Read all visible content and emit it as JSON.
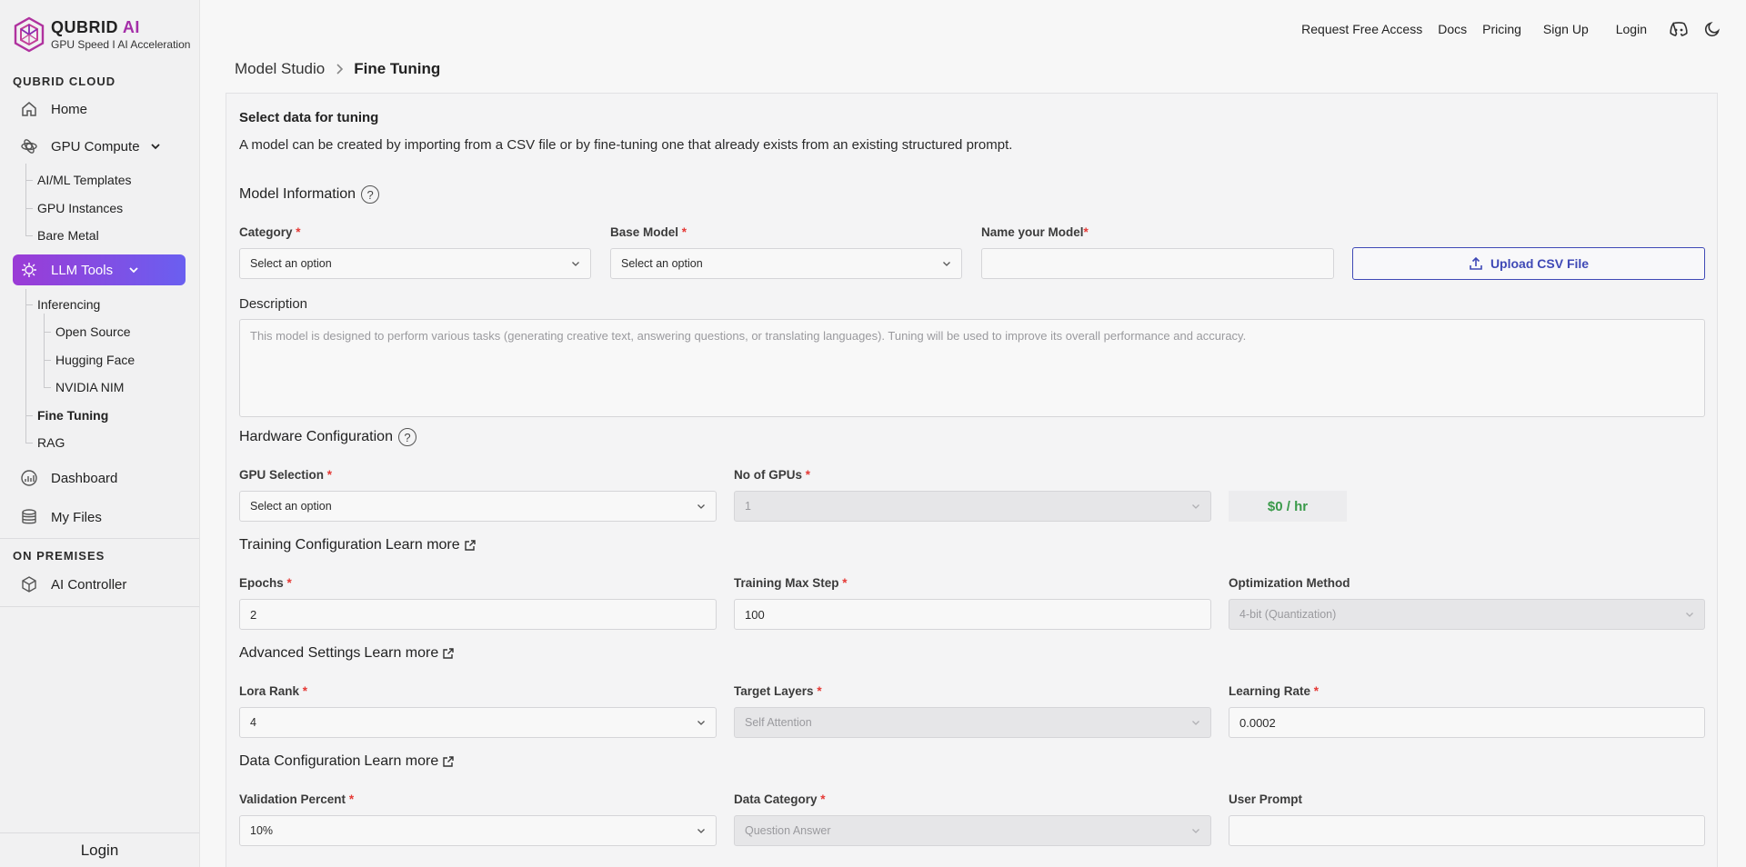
{
  "brand": {
    "name": "QUBRID",
    "name_suffix": "AI",
    "tagline": "GPU Speed I AI Acceleration"
  },
  "sidebar": {
    "cloud_title": "QUBRID CLOUD",
    "home": "Home",
    "gpu_compute": "GPU Compute",
    "gpu_sub": [
      "AI/ML Templates",
      "GPU Instances",
      "Bare Metal"
    ],
    "llm_tools": "LLM Tools",
    "inferencing": "Inferencing",
    "inferencing_sub": [
      "Open Source",
      "Hugging Face",
      "NVIDIA NIM"
    ],
    "fine_tuning": "Fine Tuning",
    "rag": "RAG",
    "dashboard": "Dashboard",
    "my_files": "My Files",
    "premises_title": "ON PREMISES",
    "ai_controller": "AI Controller",
    "login": "Login"
  },
  "topnav": {
    "request_access": "Request Free Access",
    "docs": "Docs",
    "pricing": "Pricing",
    "sign_up": "Sign Up",
    "login": "Login"
  },
  "breadcrumb": {
    "parent": "Model Studio",
    "current": "Fine Tuning"
  },
  "form": {
    "title": "Select data for tuning",
    "subtitle": "A model can be created by importing from a CSV file or by fine-tuning one that already exists from an existing structured prompt.",
    "model_info": {
      "heading": "Model Information",
      "help": "?",
      "category": {
        "label": "Category",
        "value": "Select an option"
      },
      "base_model": {
        "label": "Base Model",
        "value": "Select an option"
      },
      "name": {
        "label": "Name your Model",
        "value": ""
      },
      "upload_label": "Upload CSV File",
      "description_label": "Description",
      "description_placeholder": "This model is designed to perform various tasks (generating creative text, answering questions, or translating languages). Tuning will be used to improve its overall performance and accuracy."
    },
    "hardware": {
      "heading": "Hardware Configuration",
      "help": "?",
      "gpu_selection": {
        "label": "GPU Selection",
        "value": "Select an option"
      },
      "num_gpus": {
        "label": "No of GPUs",
        "value": "1"
      },
      "price": "$0 / hr"
    },
    "training": {
      "heading": "Training Configuration",
      "learn_more": "Learn more",
      "epochs": {
        "label": "Epochs",
        "value": "2"
      },
      "max_step": {
        "label": "Training Max Step",
        "value": "100"
      },
      "optimization": {
        "label": "Optimization Method",
        "value": "4-bit (Quantization)"
      }
    },
    "advanced": {
      "heading": "Advanced Settings",
      "learn_more": "Learn more",
      "lora_rank": {
        "label": "Lora Rank",
        "value": "4"
      },
      "target_layers": {
        "label": "Target Layers",
        "value": "Self Attention"
      },
      "learning_rate": {
        "label": "Learning Rate",
        "value": "0.0002"
      }
    },
    "data": {
      "heading": "Data Configuration",
      "learn_more": "Learn more",
      "validation": {
        "label": "Validation Percent",
        "value": "10%"
      },
      "data_category": {
        "label": "Data Category",
        "value": "Question Answer"
      },
      "user_prompt": {
        "label": "User Prompt",
        "value": ""
      }
    },
    "required_mark": "*"
  },
  "colors": {
    "accent_gradient_start": "#9b3bd6",
    "accent_gradient_end": "#6a5ff0",
    "upload_blue": "#3f49b6",
    "price_green": "#3a9a4a",
    "required_red": "#e53935"
  }
}
